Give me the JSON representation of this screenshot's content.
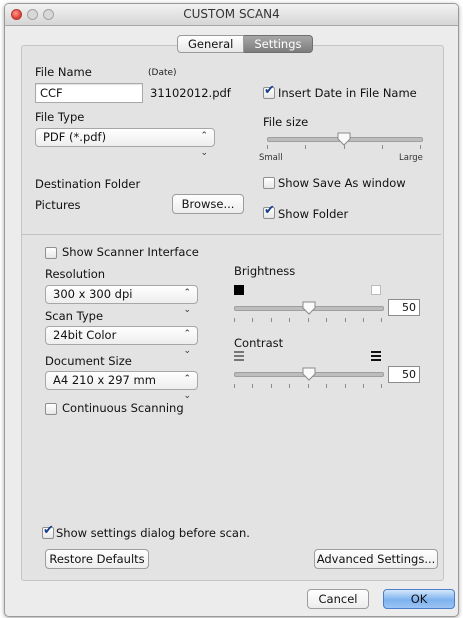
{
  "window": {
    "title": "CUSTOM SCAN4"
  },
  "tabs": [
    {
      "label": "General"
    },
    {
      "label": "Settings"
    }
  ],
  "file": {
    "name_label": "File Name",
    "date_label": "(Date)",
    "name_value": "CCF",
    "date_value": "31102012.pdf",
    "insert_date_label": "Insert Date in File Name",
    "insert_date_checked": true,
    "type_label": "File Type",
    "type_value": "PDF (*.pdf)",
    "size_label": "File size",
    "size_small": "Small",
    "size_large": "Large",
    "size_level_fraction": 0.5,
    "destination_label": "Destination Folder",
    "destination_value": "Pictures",
    "browse_label": "Browse...",
    "show_save_as_label": "Show Save As window",
    "show_save_as_checked": false,
    "show_folder_label": "Show Folder",
    "show_folder_checked": true
  },
  "scan": {
    "show_interface_label": "Show Scanner Interface",
    "show_interface_checked": false,
    "resolution_label": "Resolution",
    "resolution_value": "300 x 300 dpi",
    "type_label": "Scan Type",
    "type_value": "24bit Color",
    "doc_size_label": "Document Size",
    "doc_size_value": "A4 210 x 297 mm",
    "continuous_label": "Continuous Scanning",
    "continuous_checked": false,
    "brightness_label": "Brightness",
    "brightness_value": "50",
    "contrast_label": "Contrast",
    "contrast_value": "50"
  },
  "footer": {
    "show_dialog_label": "Show settings dialog before scan.",
    "show_dialog_checked": true,
    "restore_label": "Restore Defaults",
    "advanced_label": "Advanced Settings...",
    "cancel_label": "Cancel",
    "ok_label": "OK"
  },
  "icons": {
    "close": "close-button-icon",
    "minimize": "minimize-button-icon",
    "zoom": "zoom-button-icon",
    "popup": "popup-arrows-icon",
    "check": "checkmark-icon"
  },
  "colors": {
    "accent": "#7db2ee",
    "check": "#163e8c",
    "close": "#e2463b"
  }
}
